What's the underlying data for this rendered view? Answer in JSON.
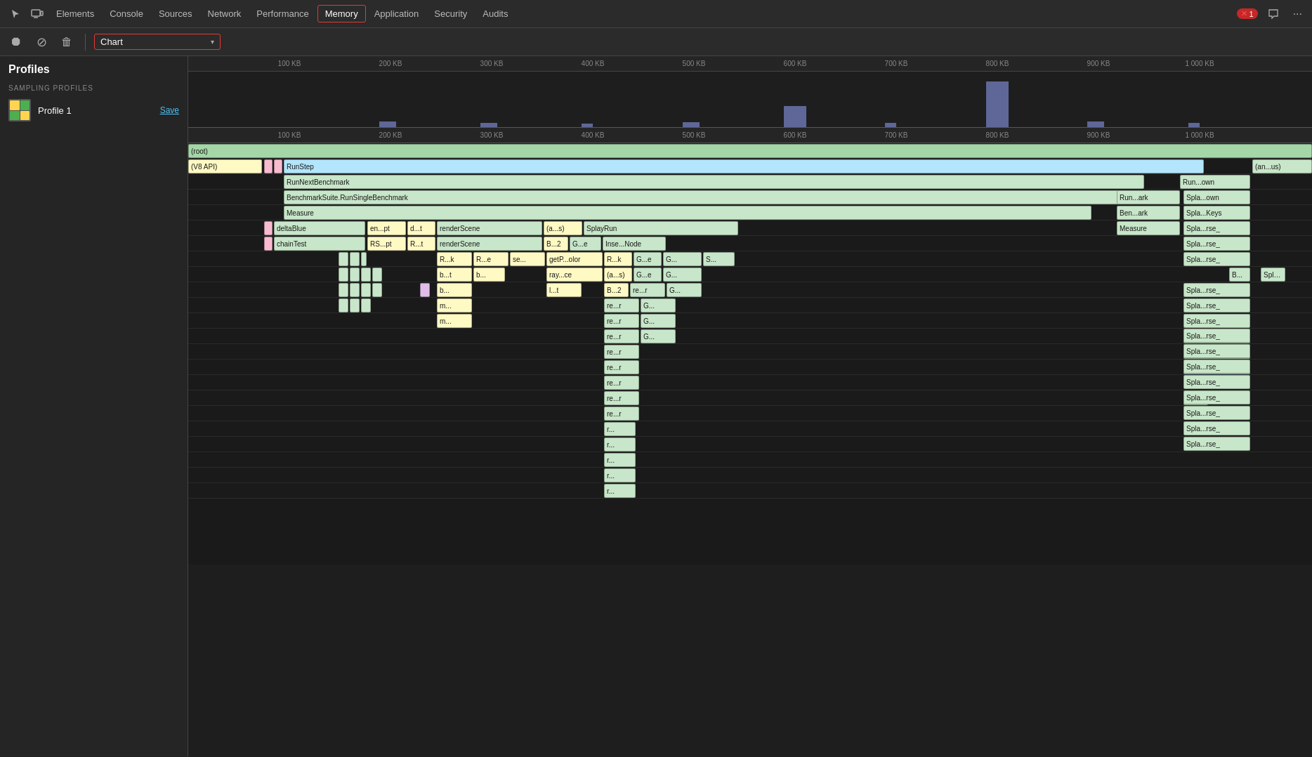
{
  "nav": {
    "tabs": [
      {
        "label": "Elements",
        "active": false
      },
      {
        "label": "Console",
        "active": false
      },
      {
        "label": "Sources",
        "active": false
      },
      {
        "label": "Network",
        "active": false
      },
      {
        "label": "Performance",
        "active": false
      },
      {
        "label": "Memory",
        "active": true
      },
      {
        "label": "Application",
        "active": false
      },
      {
        "label": "Security",
        "active": false
      },
      {
        "label": "Audits",
        "active": false
      }
    ],
    "error_count": "1",
    "more_label": "···"
  },
  "toolbar": {
    "record_label": "⏺",
    "stop_label": "⊘",
    "clear_label": "🗑",
    "chart_label": "Chart",
    "dropdown_arrow": "▾"
  },
  "sidebar": {
    "title": "Profiles",
    "section_header": "SAMPLING PROFILES",
    "profile": {
      "name": "Profile 1",
      "save_label": "Save"
    }
  },
  "ruler": {
    "labels": [
      "100 KB",
      "200 KB",
      "300 KB",
      "400 KB",
      "500 KB",
      "600 KB",
      "700 KB",
      "800 KB",
      "900 KB",
      "1 000 KB"
    ]
  },
  "flame": {
    "rows": [
      {
        "label": "(root)",
        "color": "root",
        "indent": 0
      },
      {
        "label": "(V8 API)",
        "color": "v8",
        "indent": 0
      },
      {
        "label": "RunStep",
        "color": "blue",
        "indent": 1
      },
      {
        "label": "RunNextBenchmark",
        "color": "light-green",
        "indent": 2
      },
      {
        "label": "BenchmarkSuite.RunSingleBenchmark",
        "color": "light-green",
        "indent": 2
      },
      {
        "label": "Measure",
        "color": "light-green",
        "indent": 2
      }
    ]
  }
}
